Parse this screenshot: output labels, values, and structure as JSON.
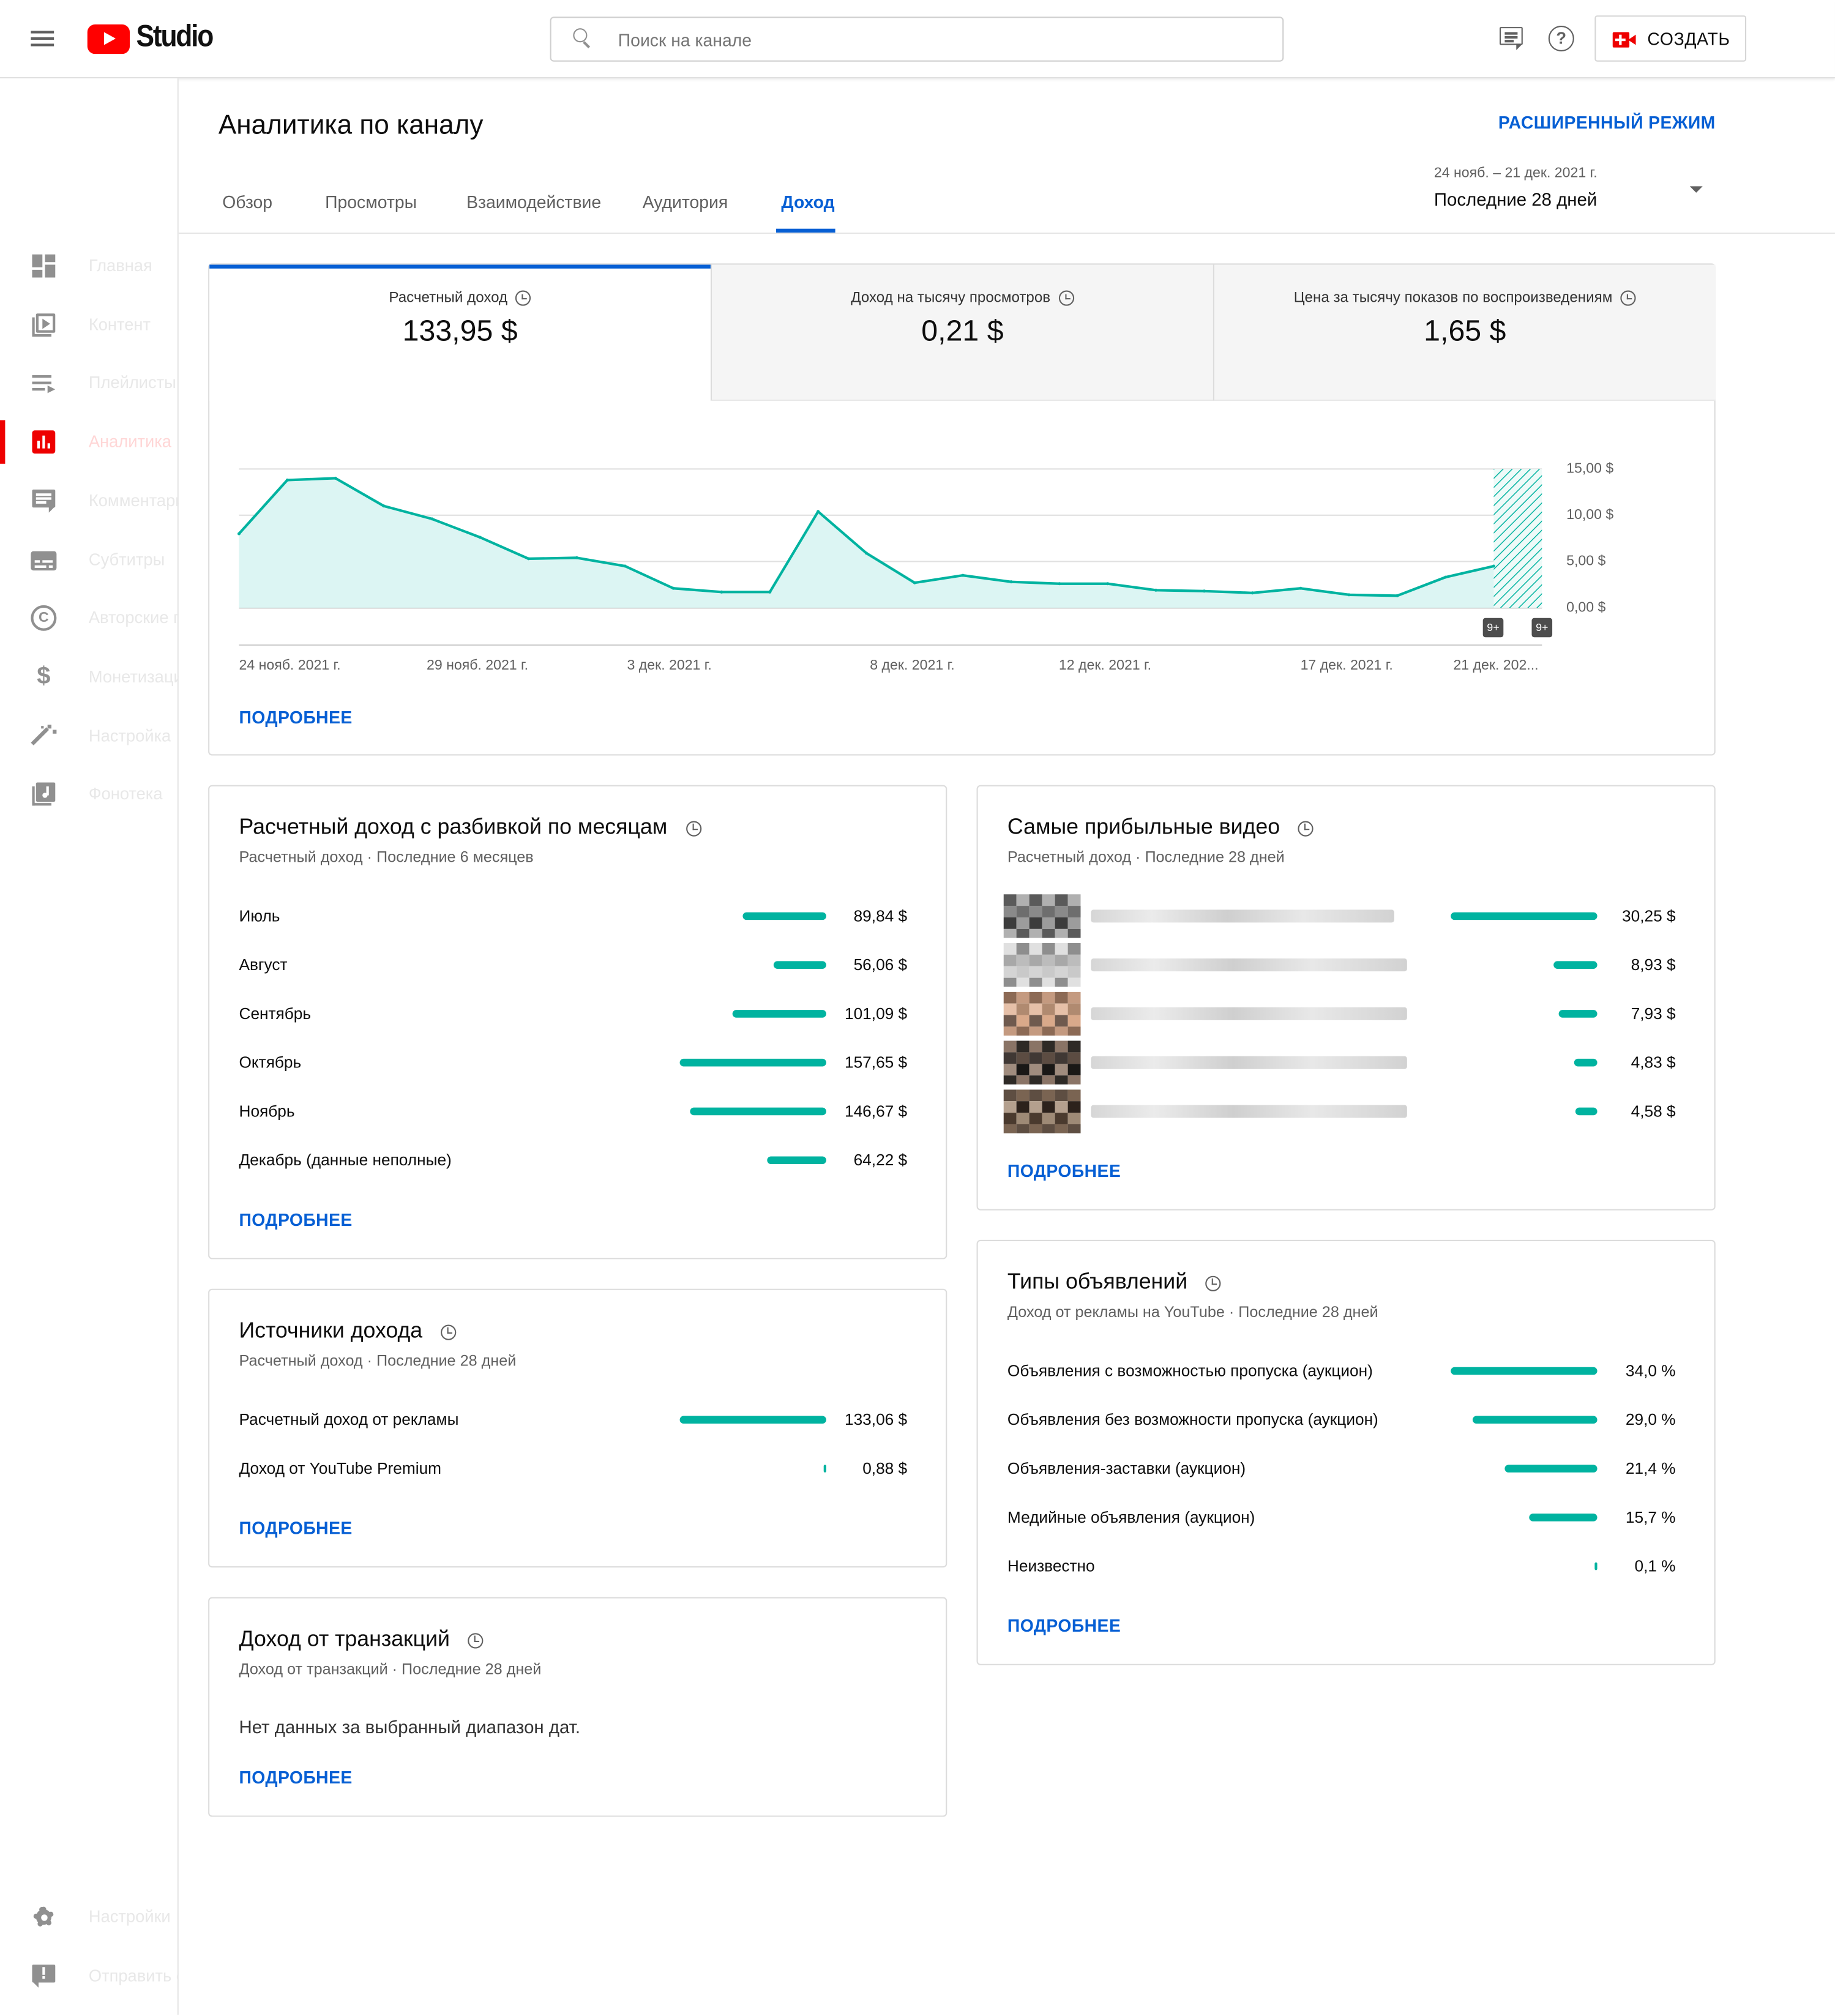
{
  "header": {
    "logo_text": "Studio",
    "search_placeholder": "Поиск на канале",
    "create_label": "СОЗДАТЬ"
  },
  "sidebar": {
    "items": [
      {
        "label": "Главная",
        "icon": "dashboard-icon"
      },
      {
        "label": "Контент",
        "icon": "video-library-icon"
      },
      {
        "label": "Плейлисты",
        "icon": "playlist-icon"
      },
      {
        "label": "Аналитика",
        "icon": "analytics-icon",
        "active": true
      },
      {
        "label": "Комментарии",
        "icon": "comments-icon"
      },
      {
        "label": "Субтитры",
        "icon": "subtitles-icon"
      },
      {
        "label": "Авторские права",
        "icon": "copyright-icon"
      },
      {
        "label": "Монетизация",
        "icon": "dollar-icon"
      },
      {
        "label": "Настройка",
        "icon": "magic-wand-icon"
      },
      {
        "label": "Фонотека",
        "icon": "audio-library-icon"
      }
    ],
    "bottom": [
      {
        "label": "Настройки",
        "icon": "gear-icon"
      },
      {
        "label": "Отправить отзыв",
        "icon": "feedback-icon"
      }
    ]
  },
  "page": {
    "title": "Аналитика по каналу",
    "advanced_mode": "РАСШИРЕННЫЙ РЕЖИМ",
    "tabs": [
      "Обзор",
      "Просмотры",
      "Взаимодействие",
      "Аудитория",
      "Доход"
    ],
    "active_tab": "Доход",
    "date_range": {
      "dates": "24 нояб. – 21 дек. 2021 г.",
      "label": "Последние 28 дней"
    }
  },
  "metrics": [
    {
      "label": "Расчетный доход",
      "value": "133,95 $"
    },
    {
      "label": "Доход на тысячу просмотров",
      "value": "0,21 $"
    },
    {
      "label": "Цена за тысячу показов по воспроизведениям",
      "value": "1,65 $"
    }
  ],
  "colors": {
    "accent": "#00b3a0",
    "fill": "#dcf5f3",
    "link": "#065fd4",
    "brand_red": "#ff0000"
  },
  "chart_data": {
    "type": "area",
    "x": [
      "24 нояб.",
      "25 нояб.",
      "26 нояб.",
      "27 нояб.",
      "28 нояб.",
      "29 нояб.",
      "30 нояб.",
      "1 дек.",
      "2 дек.",
      "3 дек.",
      "4 дек.",
      "5 дек.",
      "6 дек.",
      "7 дек.",
      "8 дек.",
      "9 дек.",
      "10 дек.",
      "11 дек.",
      "12 дек.",
      "13 дек.",
      "14 дек.",
      "15 дек.",
      "16 дек.",
      "17 дек.",
      "18 дек.",
      "19 дек.",
      "20 дек.",
      "21 дек."
    ],
    "values": [
      8.0,
      13.8,
      14.0,
      11.0,
      9.6,
      7.6,
      5.3,
      5.4,
      4.5,
      2.1,
      1.7,
      1.7,
      10.4,
      5.9,
      2.7,
      3.5,
      2.8,
      2.6,
      2.6,
      1.9,
      1.8,
      1.6,
      2.1,
      1.4,
      1.3,
      3.3,
      4.5,
      null
    ],
    "xtick_labels": [
      "24 нояб. 2021 г.",
      "29 нояб. 2021 г.",
      "3 дек. 2021 г.",
      "8 дек. 2021 г.",
      "12 дек. 2021 г.",
      "17 дек. 2021 г.",
      "21 дек. 202..."
    ],
    "ytick_labels": [
      "15,00 $",
      "10,00 $",
      "5,00 $",
      "0,00 $"
    ],
    "ylim": [
      0,
      15
    ],
    "grid": true,
    "badges": [
      "9+",
      "9+"
    ]
  },
  "monthly": {
    "title": "Расчетный доход с разбивкой по месяцам",
    "subtitle": "Расчетный доход · Последние 6 месяцев",
    "rows": [
      {
        "label": "Июль",
        "value": "89,84 $",
        "amount": 89.84
      },
      {
        "label": "Август",
        "value": "56,06 $",
        "amount": 56.06
      },
      {
        "label": "Сентябрь",
        "value": "101,09 $",
        "amount": 101.09
      },
      {
        "label": "Октябрь",
        "value": "157,65 $",
        "amount": 157.65
      },
      {
        "label": "Ноябрь",
        "value": "146,67 $",
        "amount": 146.67
      },
      {
        "label": "Декабрь (данные неполные)",
        "value": "64,22 $",
        "amount": 64.22
      }
    ],
    "more": "ПОДРОБНЕЕ"
  },
  "top_videos": {
    "title": "Самые прибыльные видео",
    "subtitle": "Расчетный доход · Последние 28 дней",
    "rows": [
      {
        "value": "30,25 $",
        "amount": 30.25
      },
      {
        "value": "8,93 $",
        "amount": 8.93
      },
      {
        "value": "7,93 $",
        "amount": 7.93
      },
      {
        "value": "4,83 $",
        "amount": 4.83
      },
      {
        "value": "4,58 $",
        "amount": 4.58
      }
    ],
    "more": "ПОДРОБНЕЕ"
  },
  "sources": {
    "title": "Источники дохода",
    "subtitle": "Расчетный доход · Последние 28 дней",
    "rows": [
      {
        "label": "Расчетный доход от рекламы",
        "value": "133,06 $",
        "amount": 133.06
      },
      {
        "label": "Доход от YouTube Premium",
        "value": "0,88 $",
        "amount": 0.88
      }
    ],
    "more": "ПОДРОБНЕЕ"
  },
  "ad_types": {
    "title": "Типы объявлений",
    "subtitle": "Доход от рекламы на YouTube · Последние 28 дней",
    "rows": [
      {
        "label": "Объявления с возможностью пропуска (аукцион)",
        "value": "34,0 %",
        "amount": 34.0
      },
      {
        "label": "Объявления без возможности пропуска (аукцион)",
        "value": "29,0 %",
        "amount": 29.0
      },
      {
        "label": "Объявления-заставки (аукцион)",
        "value": "21,4 %",
        "amount": 21.4
      },
      {
        "label": "Медийные объявления (аукцион)",
        "value": "15,7 %",
        "amount": 15.7
      },
      {
        "label": "Неизвестно",
        "value": "0,1 %",
        "amount": 0.1
      }
    ],
    "more": "ПОДРОБНЕЕ"
  },
  "transactions": {
    "title": "Доход от транзакций",
    "subtitle": "Доход от транзакций · Последние 28 дней",
    "empty": "Нет данных за выбранный диапазон дат.",
    "more": "ПОДРОБНЕЕ"
  },
  "overview_more": "ПОДРОБНЕЕ"
}
